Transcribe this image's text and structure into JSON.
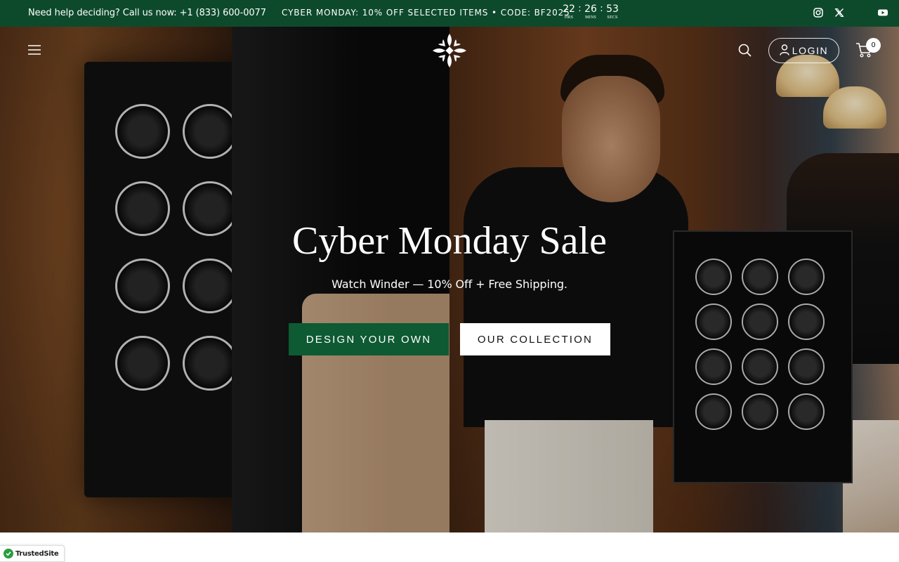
{
  "announcement": {
    "help_text": "Need help deciding? Call us now: +1 (833) 600-0077",
    "promo_text": "CYBER MONDAY: 10% OFF SELECTED ITEMS • CODE: BF2025",
    "countdown": {
      "hours": "22",
      "hours_label": "HRS",
      "minutes": "26",
      "minutes_label": "MINS",
      "seconds": "53",
      "seconds_label": "SECS"
    },
    "social": [
      "instagram-icon",
      "x-twitter-icon",
      "youtube-icon"
    ]
  },
  "header": {
    "menu_icon": "hamburger-menu-icon",
    "logo_icon": "fleur-cross-logo",
    "search_icon": "search-icon",
    "login_label": "LOGIN",
    "cart_count": "0"
  },
  "hero": {
    "title": "Cyber Monday Sale",
    "subtitle": "Watch Winder — 10% Off + Free Shipping.",
    "primary_button": "DESIGN YOUR OWN",
    "secondary_button": "OUR COLLECTION"
  },
  "trust_badge": {
    "label": "TrustedSite"
  },
  "colors": {
    "brand_green": "#0d4a2c",
    "button_green": "#0d5a33",
    "white": "#ffffff"
  }
}
